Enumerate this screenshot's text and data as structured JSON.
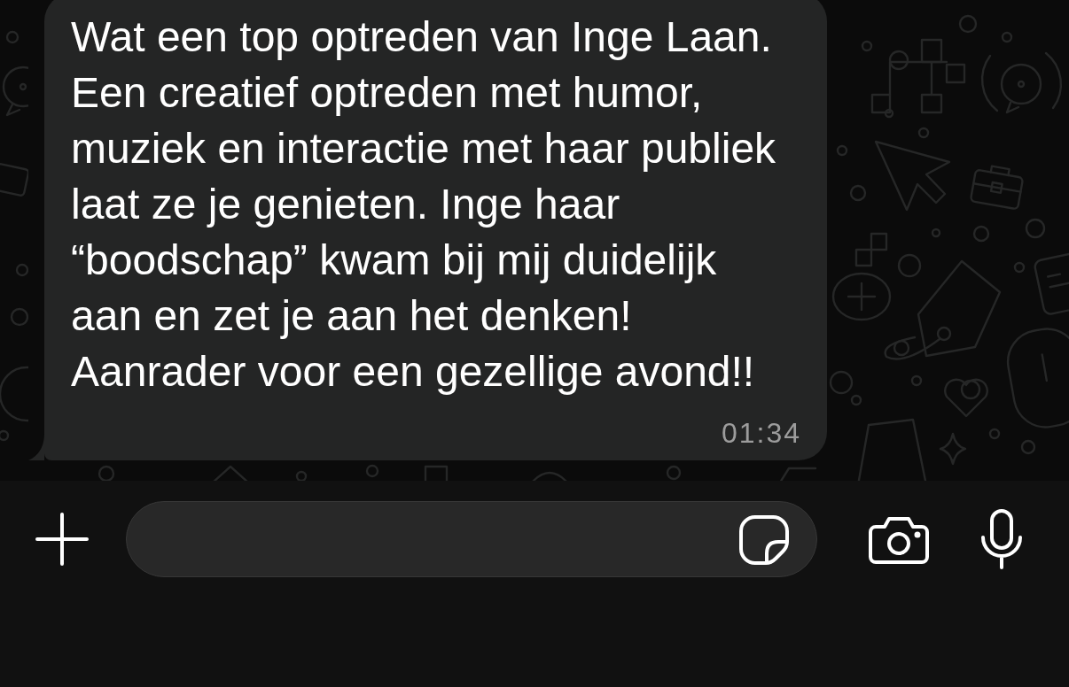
{
  "messages": [
    {
      "text": "Wat een top optreden van Inge Laan. Een creatief optreden met humor, muziek en interactie met haar publiek laat ze je genieten. Inge haar “boodschap” kwam bij mij duidelijk aan en zet je aan het denken! Aanrader voor een gezellige avond!!",
      "time": "01:34"
    }
  ]
}
